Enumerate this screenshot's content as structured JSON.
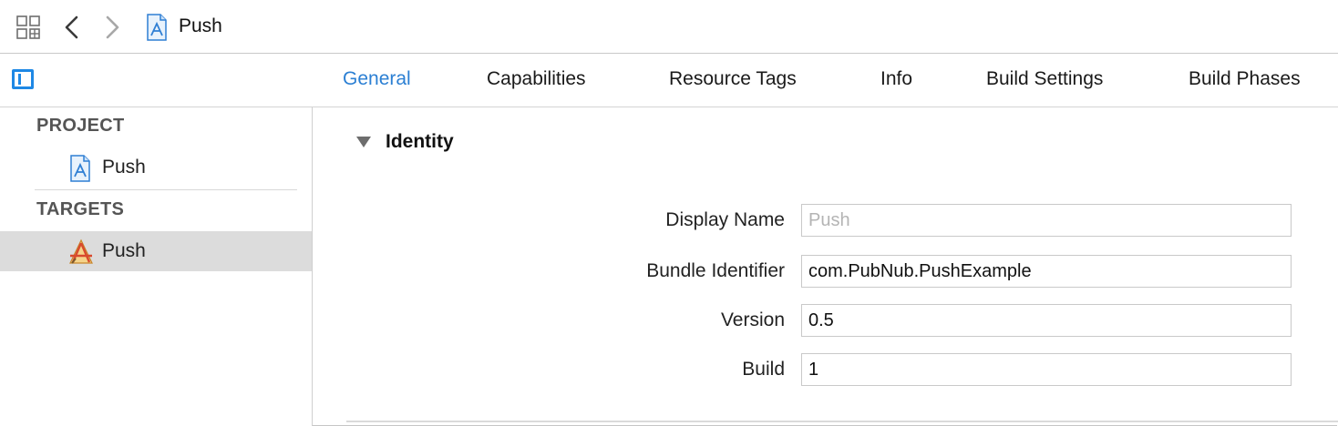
{
  "navbar": {
    "breadcrumb": "Push"
  },
  "tabs": [
    {
      "label": "General",
      "active": true
    },
    {
      "label": "Capabilities",
      "active": false
    },
    {
      "label": "Resource Tags",
      "active": false
    },
    {
      "label": "Info",
      "active": false
    },
    {
      "label": "Build Settings",
      "active": false
    },
    {
      "label": "Build Phases",
      "active": false
    }
  ],
  "sidebar": {
    "project_header": "PROJECT",
    "project_item": "Push",
    "targets_header": "TARGETS",
    "target_item": "Push"
  },
  "identity": {
    "title": "Identity",
    "fields": [
      {
        "label": "Display Name",
        "value": "",
        "placeholder": "Push"
      },
      {
        "label": "Bundle Identifier",
        "value": "com.PubNub.PushExample",
        "placeholder": ""
      },
      {
        "label": "Version",
        "value": "0.5",
        "placeholder": ""
      },
      {
        "label": "Build",
        "value": "1",
        "placeholder": ""
      }
    ]
  },
  "colors": {
    "accent": "#2b7fd3",
    "selection": "#dcdcdc"
  },
  "icons": [
    "related-items-icon",
    "back-arrow-icon",
    "forward-arrow-icon",
    "project-file-icon",
    "sidebar-toggle-icon",
    "app-target-icon",
    "disclosure-triangle-icon"
  ]
}
